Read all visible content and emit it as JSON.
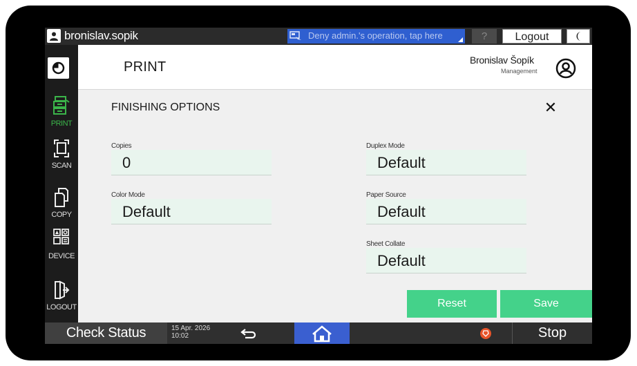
{
  "topbar": {
    "username": "bronislav.sopik",
    "deny_notice": "Deny admin.'s operation, tap here",
    "help_label": "?",
    "logout_label": "Logout"
  },
  "sidebar": {
    "items": [
      {
        "label": "PRINT",
        "icon": "printer-icon",
        "active": true
      },
      {
        "label": "SCAN",
        "icon": "scan-icon",
        "active": false
      },
      {
        "label": "COPY",
        "icon": "copy-icon",
        "active": false
      },
      {
        "label": "DEVICE",
        "icon": "device-icon",
        "active": false
      },
      {
        "label": "LOGOUT",
        "icon": "logout-icon",
        "active": false
      }
    ]
  },
  "header": {
    "title": "PRINT",
    "user_name": "Bronislav Šopík",
    "user_role": "Management"
  },
  "finishing": {
    "section_title": "FINISHING OPTIONS",
    "copies": {
      "label": "Copies",
      "value": "0"
    },
    "color_mode": {
      "label": "Color Mode",
      "value": "Default"
    },
    "duplex_mode": {
      "label": "Duplex Mode",
      "value": "Default"
    },
    "paper_source": {
      "label": "Paper Source",
      "value": "Default"
    },
    "sheet_collate": {
      "label": "Sheet Collate",
      "value": "Default"
    }
  },
  "actions": {
    "reset_label": "Reset",
    "save_label": "Save"
  },
  "bottombar": {
    "check_status_label": "Check Status",
    "date": "15 Apr. 2026",
    "time": "10:02",
    "stop_label": "Stop"
  },
  "colors": {
    "accent_green": "#44d28a",
    "active_nav_green": "#3bb54a",
    "home_blue": "#3a5fd0",
    "field_bg": "#e9f5ee",
    "stop_orange": "#e8542a"
  }
}
